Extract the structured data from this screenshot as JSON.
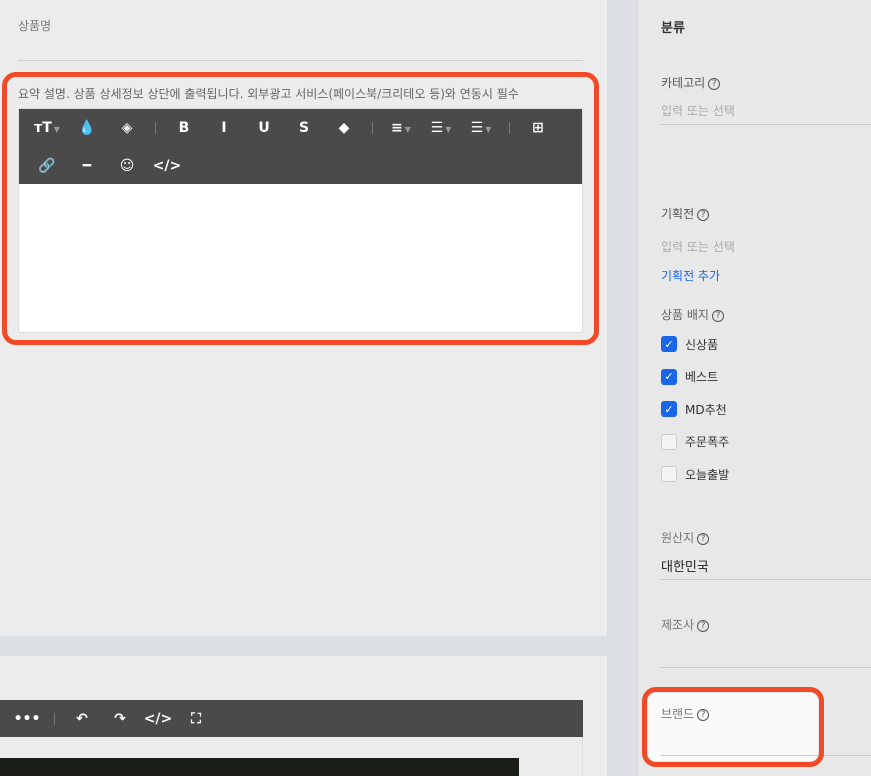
{
  "left": {
    "product_name_label": "상품명",
    "summary_placeholder": "요약 설명. 상품 상세정보 상단에 출력됩니다. 외부광고 서비스(페이스북/크리테오 등)와 연동시 필수",
    "toolbar_row1": [
      {
        "icon": "text-size-icon",
        "glyph": "тT",
        "caret": true
      },
      {
        "icon": "text-color-icon",
        "glyph": "💧"
      },
      {
        "icon": "bg-color-icon",
        "glyph": "◈"
      },
      {
        "icon": "bold-icon",
        "glyph": "B"
      },
      {
        "icon": "italic-icon",
        "glyph": "I"
      },
      {
        "icon": "underline-icon",
        "glyph": "U"
      },
      {
        "icon": "strikethrough-icon",
        "glyph": "S"
      },
      {
        "icon": "eraser-icon",
        "glyph": "◆"
      },
      {
        "icon": "align-icon",
        "glyph": "≡",
        "caret": true
      },
      {
        "icon": "ordered-list-icon",
        "glyph": "☰",
        "caret": true
      },
      {
        "icon": "unordered-list-icon",
        "glyph": "☰",
        "caret": true
      },
      {
        "icon": "table-icon",
        "glyph": "⊞"
      }
    ],
    "toolbar_row2": [
      {
        "icon": "link-icon",
        "glyph": "🔗"
      },
      {
        "icon": "horizontal-rule-icon",
        "glyph": "━"
      },
      {
        "icon": "emoji-icon",
        "glyph": "☺"
      },
      {
        "icon": "code-view-icon",
        "glyph": "</>"
      }
    ],
    "toolbar2": [
      {
        "icon": "more-icon",
        "glyph": "•••"
      },
      {
        "icon": "undo-icon",
        "glyph": "↶"
      },
      {
        "icon": "redo-icon",
        "glyph": "↷"
      },
      {
        "icon": "code-view-icon",
        "glyph": "</>"
      },
      {
        "icon": "fullscreen-icon",
        "glyph": "⛶"
      }
    ]
  },
  "right": {
    "section_title": "분류",
    "category_label": "카테고리",
    "category_placeholder": "입력 또는 선택",
    "promo_label": "기획전",
    "promo_placeholder": "입력 또는 선택",
    "promo_add": "기획전 추가",
    "badge_label": "상품 배지",
    "badges": [
      {
        "label": "신상품",
        "checked": true
      },
      {
        "label": "베스트",
        "checked": true
      },
      {
        "label": "MD추천",
        "checked": true
      },
      {
        "label": "주문폭주",
        "checked": false
      },
      {
        "label": "오늘출발",
        "checked": false
      }
    ],
    "origin_label": "원산지",
    "origin_value": "대한민국",
    "maker_label": "제조사",
    "brand_label": "브랜드",
    "help_glyph": "?"
  },
  "colors": {
    "accent": "#1a66e8",
    "highlight": "#f24a26",
    "toolbar": "#4a4a4a"
  }
}
